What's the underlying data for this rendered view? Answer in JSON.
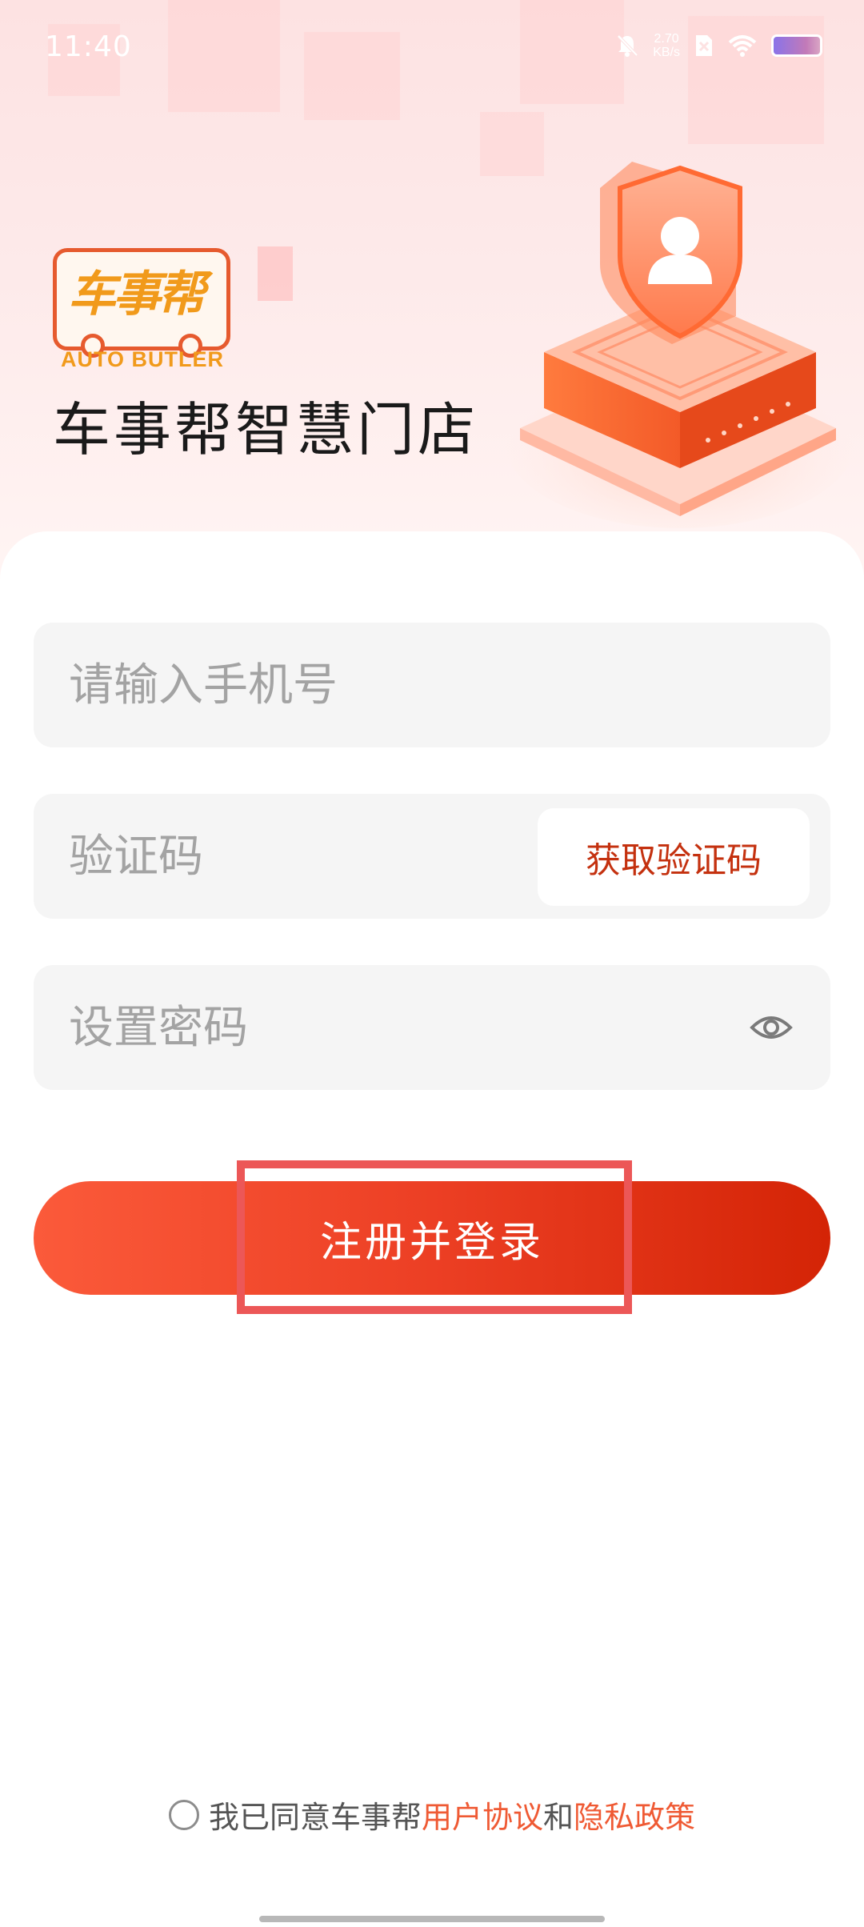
{
  "status_bar": {
    "time": "11:40",
    "net_speed_value": "2.70",
    "net_speed_unit": "KB/s",
    "icons": [
      "mute-bell-icon",
      "sim-icon",
      "wifi-icon",
      "battery-icon"
    ]
  },
  "brand": {
    "logo_text": "车事帮",
    "logo_sub": "AUTO BUTLER",
    "app_title": "车事帮智慧门店",
    "illustration": "shield-user-icon"
  },
  "form": {
    "phone": {
      "placeholder": "请输入手机号",
      "value": ""
    },
    "code": {
      "placeholder": "验证码",
      "value": "",
      "button_label": "获取验证码"
    },
    "password": {
      "placeholder": "设置密码",
      "value": "",
      "toggle_icon": "eye-icon"
    },
    "submit_label": "注册并登录"
  },
  "agreement": {
    "prefix": "我已同意车事帮",
    "user_agreement": "用户协议",
    "conjunction": "和",
    "privacy_policy": "隐私政策",
    "checked": false
  },
  "colors": {
    "accent": "#ec3f24",
    "link": "#ef5a34",
    "code_button_text": "#c4310f",
    "logo_orange": "#f19a1b"
  }
}
